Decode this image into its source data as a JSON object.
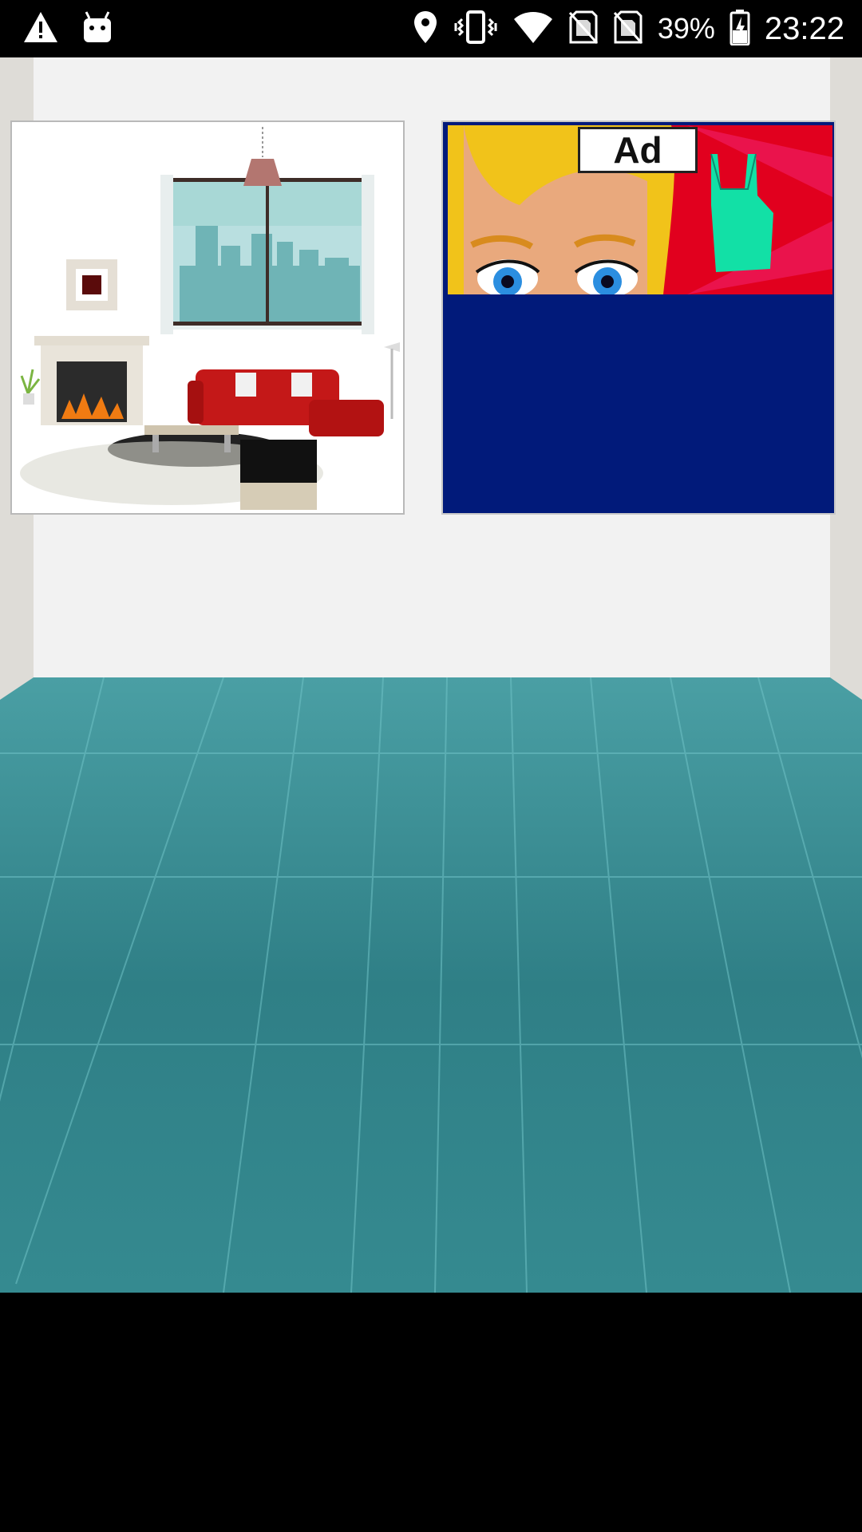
{
  "status_bar": {
    "left_icons": [
      "warning-icon",
      "android-debug-icon"
    ],
    "right_icons": [
      "location-icon",
      "vibrate-icon",
      "wifi-icon",
      "no-sim-icon",
      "no-sim-icon",
      "battery-charging-icon"
    ],
    "battery_percent": "39%",
    "time": "23:22"
  },
  "thumbnails": {
    "left": {
      "icon": "living-room-scene-icon"
    },
    "right": {
      "ad_badge": "Ad",
      "icon": "cartoon-face-ad-icon"
    }
  },
  "colors": {
    "wall": "#f2f2f2",
    "wall_side": "#dedcd7",
    "floor": "#3f8f94",
    "ad_background": "#011a7a",
    "ad_banner": "#e0001e"
  }
}
